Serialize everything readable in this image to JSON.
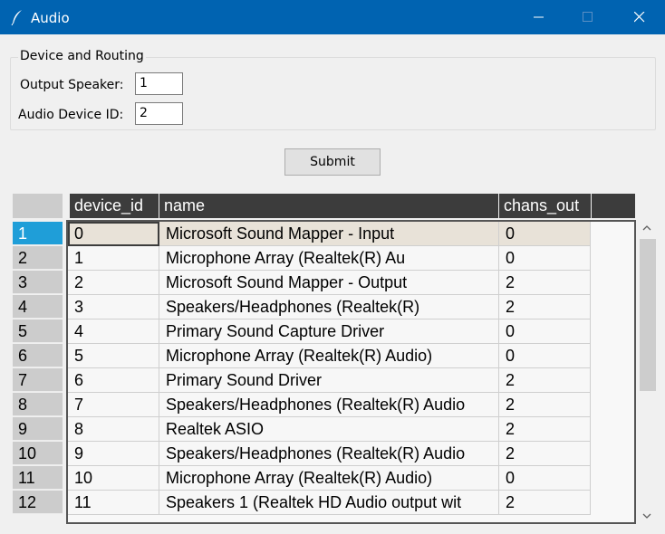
{
  "window": {
    "title": "Audio"
  },
  "group": {
    "title": "Device and Routing",
    "output_speaker_label": "Output Speaker:",
    "output_speaker_value": "1",
    "device_id_label": "Audio Device ID:",
    "device_id_value": "2"
  },
  "submit_label": "Submit",
  "table": {
    "columns": [
      "device_id",
      "name",
      "chans_out"
    ],
    "selected_row": 0,
    "rows": [
      {
        "index": "1",
        "device_id": "0",
        "name": "Microsoft Sound Mapper - Input",
        "chans_out": "0"
      },
      {
        "index": "2",
        "device_id": "1",
        "name": "Microphone Array (Realtek(R) Au",
        "chans_out": "0"
      },
      {
        "index": "3",
        "device_id": "2",
        "name": "Microsoft Sound Mapper - Output",
        "chans_out": "2"
      },
      {
        "index": "4",
        "device_id": "3",
        "name": "Speakers/Headphones (Realtek(R)",
        "chans_out": "2"
      },
      {
        "index": "5",
        "device_id": "4",
        "name": "Primary Sound Capture Driver",
        "chans_out": "0"
      },
      {
        "index": "6",
        "device_id": "5",
        "name": "Microphone Array (Realtek(R) Audio)",
        "chans_out": "0"
      },
      {
        "index": "7",
        "device_id": "6",
        "name": "Primary Sound Driver",
        "chans_out": "2"
      },
      {
        "index": "8",
        "device_id": "7",
        "name": "Speakers/Headphones (Realtek(R) Audio",
        "chans_out": "2"
      },
      {
        "index": "9",
        "device_id": "8",
        "name": "Realtek ASIO",
        "chans_out": "2"
      },
      {
        "index": "10",
        "device_id": "9",
        "name": "Speakers/Headphones (Realtek(R) Audio",
        "chans_out": "2"
      },
      {
        "index": "11",
        "device_id": "10",
        "name": "Microphone Array (Realtek(R) Audio)",
        "chans_out": "0"
      },
      {
        "index": "12",
        "device_id": "11",
        "name": "Speakers 1 (Realtek HD Audio output wit",
        "chans_out": "2"
      }
    ]
  },
  "colors": {
    "titlebar": "#0063b1",
    "header": "#3c3c3c",
    "index_selected": "#1f9ed8",
    "row_selected": "#e8e2d8"
  },
  "icons": [
    "feather-icon",
    "minimize-icon",
    "maximize-icon",
    "close-icon",
    "scroll-up-arrow-icon",
    "scroll-down-arrow-icon"
  ]
}
